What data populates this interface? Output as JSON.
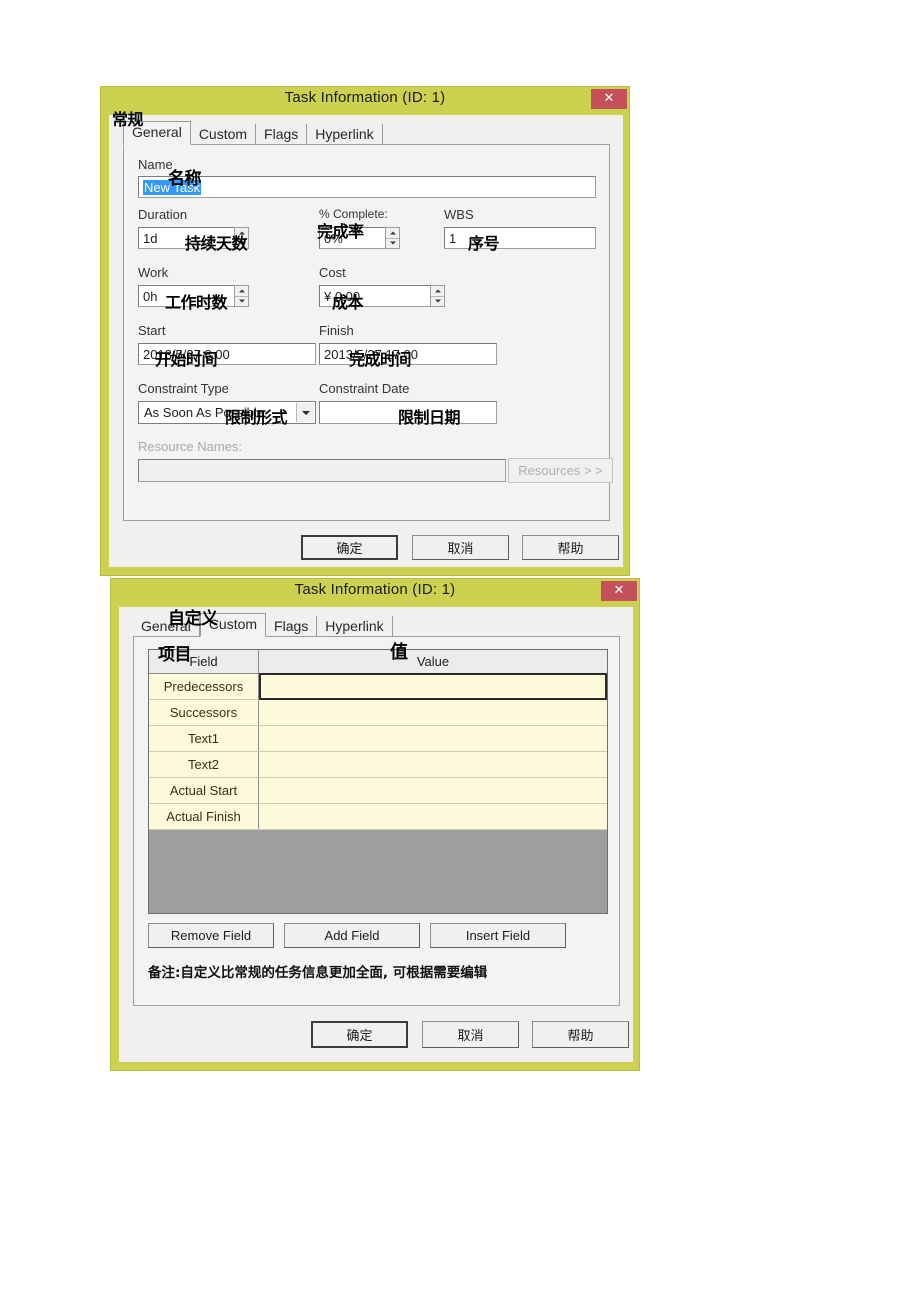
{
  "dialog_general": {
    "title": "Task Information (ID: 1)",
    "close_label": "✕",
    "tabs": [
      {
        "label": "General",
        "active": true
      },
      {
        "label": "Custom",
        "active": false
      },
      {
        "label": "Flags",
        "active": false
      },
      {
        "label": "Hyperlink",
        "active": false
      }
    ],
    "fields": {
      "name_label": "Name",
      "name_value": "New Task",
      "duration_label": "Duration",
      "duration_value": "1d",
      "percent_label": "% Complete:",
      "percent_value": "0%",
      "wbs_label": "WBS",
      "wbs_value": "1",
      "work_label": "Work",
      "work_value": "0h",
      "cost_label": "Cost",
      "cost_value": "¥ 0.00",
      "start_label": "Start",
      "start_value": "2013/5/27 8:00",
      "finish_label": "Finish",
      "finish_value": "2013/5/27 17:00",
      "constraint_type_label": "Constraint Type",
      "constraint_type_value": "As Soon As Possible",
      "constraint_date_label": "Constraint Date",
      "constraint_date_value": "",
      "resource_names_label": "Resource Names:",
      "resource_names_value": "",
      "resources_button": "Resources  >  >"
    },
    "buttons": {
      "ok": "确定",
      "cancel": "取消",
      "help": "帮助"
    },
    "annotations": {
      "general_tab": "常规",
      "name": "名称",
      "duration": "持续天数",
      "percent": "完成率",
      "wbs": "序号",
      "work": "工作时数",
      "cost": "成本",
      "start": "开始时间",
      "finish": "完成时间",
      "constraint_type": "限制形式",
      "constraint_date": "限制日期"
    }
  },
  "dialog_custom": {
    "title": "Task Information (ID: 1)",
    "close_label": "✕",
    "tabs": [
      {
        "label": "General",
        "active": false
      },
      {
        "label": "Custom",
        "active": true
      },
      {
        "label": "Flags",
        "active": false
      },
      {
        "label": "Hyperlink",
        "active": false
      }
    ],
    "table": {
      "headers": [
        "Field",
        "Value"
      ],
      "rows": [
        {
          "field": "Predecessors",
          "value": "",
          "selected": true
        },
        {
          "field": "Successors",
          "value": "",
          "selected": false
        },
        {
          "field": "Text1",
          "value": "",
          "selected": false
        },
        {
          "field": "Text2",
          "value": "",
          "selected": false
        },
        {
          "field": "Actual Start",
          "value": "",
          "selected": false
        },
        {
          "field": "Actual Finish",
          "value": "",
          "selected": false
        }
      ]
    },
    "field_buttons": {
      "remove": "Remove Field",
      "add": "Add Field",
      "insert": "Insert Field"
    },
    "note": "备注:自定义比常规的任务信息更加全面, 可根据需要编辑",
    "buttons": {
      "ok": "确定",
      "cancel": "取消",
      "help": "帮助"
    },
    "annotations": {
      "custom_tab": "自定义",
      "field_col": "项目",
      "value_col": "值"
    }
  },
  "colors": {
    "titlebar": "#ccd24f",
    "close_button": "#c4515a",
    "client": "#f0f0f0",
    "row_bg": "#fcfada",
    "grid_filler": "#9e9e9e",
    "selection": "#3399ff"
  }
}
